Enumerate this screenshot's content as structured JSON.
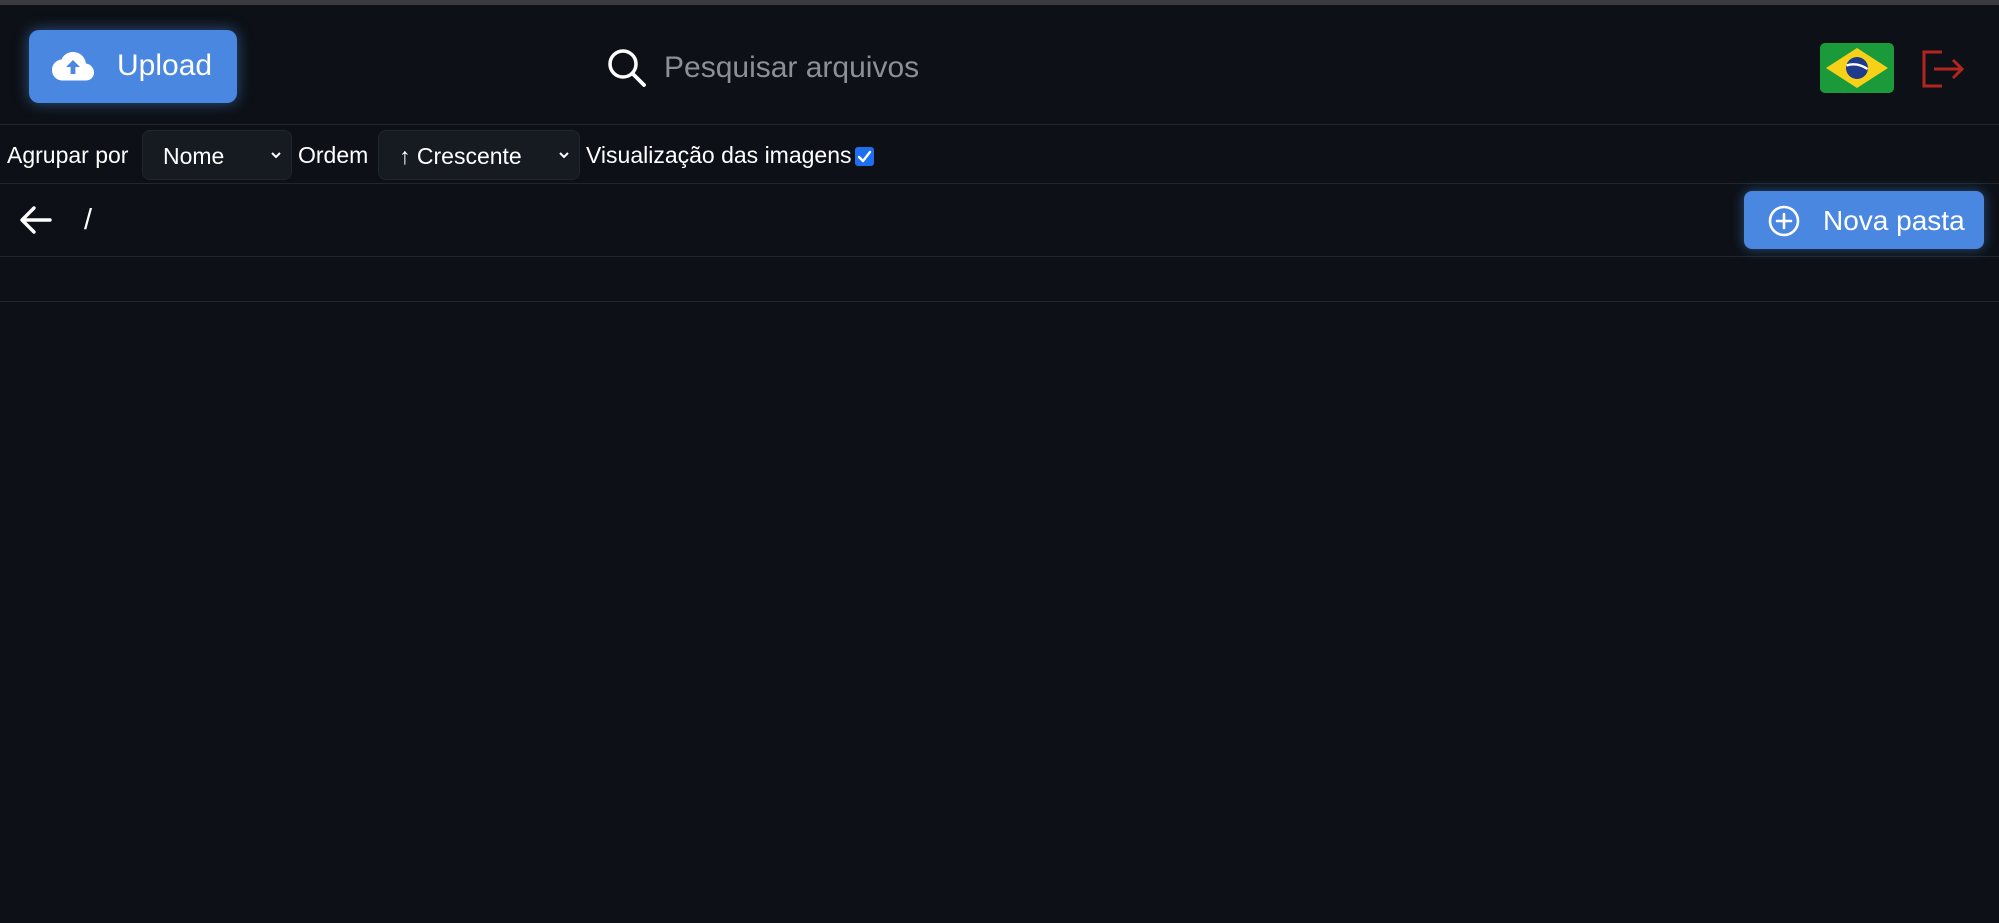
{
  "header": {
    "upload_label": "Upload",
    "upload_icon": "cloud-upload-icon",
    "search_placeholder": "Pesquisar arquivos",
    "search_value": "",
    "language_flag": "brazil-flag-icon",
    "logout_icon": "logout-icon"
  },
  "toolbar": {
    "group_by_label": "Agrupar por",
    "group_by_value": "Nome",
    "order_label": "Ordem",
    "order_value": "↑ Crescente",
    "image_preview_label": "Visualização das imagens",
    "image_preview_checked": true
  },
  "pathbar": {
    "back_icon": "arrow-left-icon",
    "current_path": "/",
    "new_folder_label": "Nova pasta",
    "new_folder_icon": "plus-circle-icon"
  },
  "colors": {
    "background": "#0d1117",
    "accent": "#4a87e0",
    "border": "#21262d",
    "logout": "#b3261e",
    "checkbox": "#1e6ff0"
  },
  "file_list": []
}
